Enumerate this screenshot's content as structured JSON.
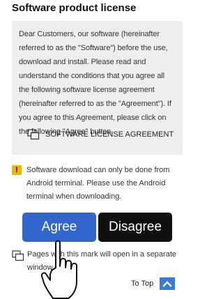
{
  "page": {
    "title": "Software product license"
  },
  "license": {
    "text": "Dear Customers, our software (hereinafter referred to as the \"Software\") before the use, download and install. Please read and understand the conditions that you agree all the following software license agreement (hereinafter referred to as the \"Agreement\"). If you agree to this Agreement, please click on the following \"Agree\" button.",
    "link_label": "SOFTWARE LICENSE AGREEMENT",
    "link_icon": "new-window-icon"
  },
  "warning": {
    "icon_symbol": "!",
    "icon_color": "#f2b200",
    "text": "Software download can only be done from Android terminal. Please use the Android terminal when downloading."
  },
  "buttons": {
    "agree_label": "Agree",
    "agree_color": "#3366cc",
    "disagree_label": "Disagree",
    "disagree_color": "#101010"
  },
  "note": {
    "icon": "new-window-icon",
    "text": "Pages with this mark will open in a separate window."
  },
  "footer": {
    "to_top_label": "To Top",
    "to_top_icon": "chevron-up-icon",
    "to_top_color": "#3a7bd5"
  },
  "overlay": {
    "pointer_icon": "hand-pointer-icon"
  }
}
